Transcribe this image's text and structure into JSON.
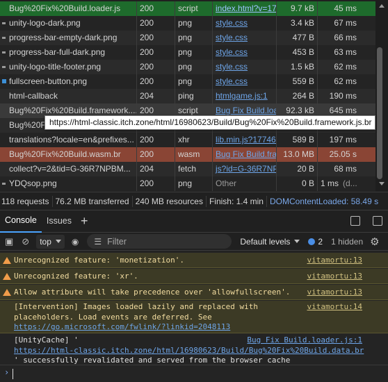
{
  "network": {
    "rows": [
      {
        "name": "Bug%20Fix%20Build.loader.js",
        "status": "200",
        "type": "script",
        "initiator": "index.html?v=17",
        "size": "9.7 kB",
        "time": "45 ms"
      },
      {
        "name": "unity-logo-dark.png",
        "status": "200",
        "type": "png",
        "initiator": "style.css",
        "size": "3.4 kB",
        "time": "67 ms"
      },
      {
        "name": "progress-bar-empty-dark.png",
        "status": "200",
        "type": "png",
        "initiator": "style.css",
        "size": "477 B",
        "time": "66 ms"
      },
      {
        "name": "progress-bar-full-dark.png",
        "status": "200",
        "type": "png",
        "initiator": "style.css",
        "size": "453 B",
        "time": "63 ms"
      },
      {
        "name": "unity-logo-title-footer.png",
        "status": "200",
        "type": "png",
        "initiator": "style.css",
        "size": "1.5 kB",
        "time": "62 ms"
      },
      {
        "name": "fullscreen-button.png",
        "status": "200",
        "type": "png",
        "initiator": "style.css",
        "size": "559 B",
        "time": "62 ms"
      },
      {
        "name": "html-callback",
        "status": "204",
        "type": "ping",
        "initiator": "htmlgame.js:1",
        "size": "264 B",
        "time": "190 ms"
      },
      {
        "name": "Bug%20Fix%20Build.framework....",
        "status": "200",
        "type": "script",
        "initiator": "Bug Fix Build.loa",
        "size": "92.3 kB",
        "time": "645 ms"
      },
      {
        "name": "Bug%20F",
        "status": "",
        "type": "",
        "initiator": "",
        "size": "",
        "time": ""
      },
      {
        "name": "translations?locale=en&prefixes...",
        "status": "200",
        "type": "xhr",
        "initiator": "lib.min.js?177464",
        "size": "589 B",
        "time": "197 ms"
      },
      {
        "name": "Bug%20Fix%20Build.wasm.br",
        "status": "200",
        "type": "wasm",
        "initiator": "Bug Fix Build.fra",
        "size": "13.0 MB",
        "time": "25.05 s"
      },
      {
        "name": "collect?v=2&tid=G-36R7NPBM...",
        "status": "204",
        "type": "fetch",
        "initiator": "js?id=G-36R7NP",
        "size": "20 B",
        "time": "68 ms"
      },
      {
        "name": "YDQsop.png",
        "status": "200",
        "type": "png",
        "initiator": "Other",
        "size": "0 B",
        "time": "1 ms",
        "extra": "(d..."
      }
    ],
    "tooltip": "https://html-classic.itch.zone/html/16980623/Build/Bug%20Fix%20Build.framework.js.br"
  },
  "summary": {
    "requests": "118 requests",
    "transferred": "76.2 MB transferred",
    "resources": "240 MB resources",
    "finish": "Finish: 1.4 min",
    "dcl": "DOMContentLoaded: 58.49 s"
  },
  "drawer": {
    "tabs": [
      "Console",
      "Issues"
    ],
    "add_tab": "+"
  },
  "toolbar": {
    "context": "top",
    "filter_placeholder": "Filter",
    "levels": "Default levels",
    "issues_count": "2",
    "hidden": "1 hidden"
  },
  "console": {
    "warnings": [
      {
        "text": "Unrecognized feature: 'monetization'.",
        "source": "vitamortu:13"
      },
      {
        "text": "Unrecognized feature: 'xr'.",
        "source": "vitamortu:13"
      },
      {
        "text": "Allow attribute will take precedence over 'allowfullscreen'.",
        "source": "vitamortu:13"
      }
    ],
    "intervention": {
      "line1": "[Intervention] Images loaded lazily and replaced with",
      "line2": "placeholders. Load events are deferred. See",
      "link": "https://go.microsoft.com/fwlink/?linkid=2048113",
      "source": "vitamortu:14"
    },
    "log": {
      "line1": "[UnityCache] '",
      "link": "https://html-classic.itch.zone/html/16980623/Build/Bug%20Fix%20Build.data.br",
      "line3": "' successfully revalidated and served from the browser cache",
      "source": "Bug Fix Build.loader.js:1"
    },
    "prompt": "›"
  }
}
